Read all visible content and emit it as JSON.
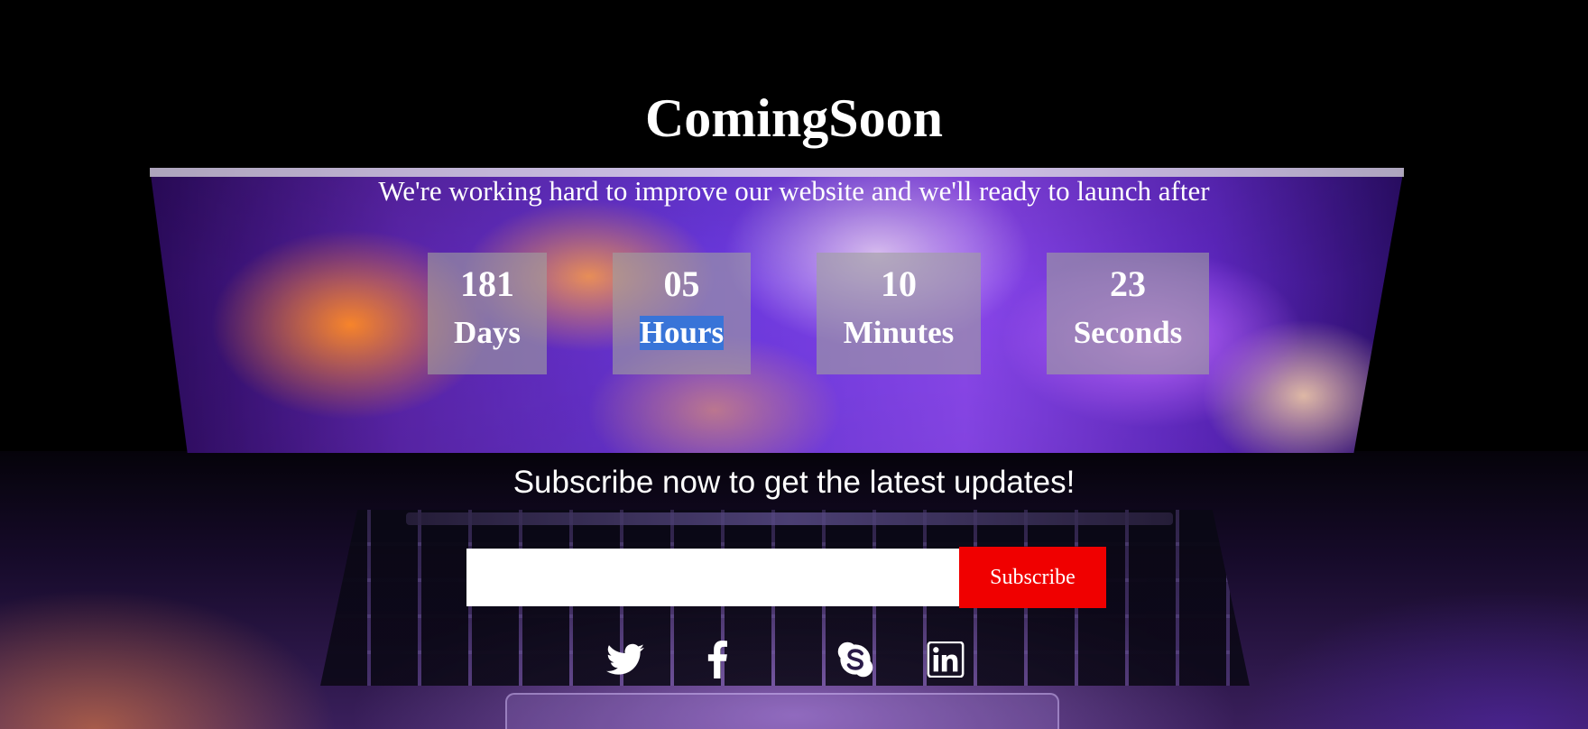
{
  "page": {
    "title": "ComingSoon",
    "subtitle": "We're working hard to improve our website and we'll ready to launch after"
  },
  "countdown": [
    {
      "value": "181",
      "label": "Days"
    },
    {
      "value": "05",
      "label": "Hours"
    },
    {
      "value": "10",
      "label": "Minutes"
    },
    {
      "value": "23",
      "label": "Seconds"
    }
  ],
  "subscribe": {
    "heading": "Subscribe now to get the latest updates!",
    "email_value": "",
    "email_placeholder": "",
    "button_label": "Subscribe"
  },
  "social": [
    {
      "icon": "twitter-icon"
    },
    {
      "icon": "facebook-icon"
    },
    {
      "icon": "skype-icon"
    },
    {
      "icon": "linkedin-icon"
    }
  ],
  "colors": {
    "background": "#000000",
    "countdown_box": "#a0a0a0",
    "selection_highlight": "#3874d8",
    "subscribe_button": "#f00000",
    "text": "#ffffff"
  }
}
